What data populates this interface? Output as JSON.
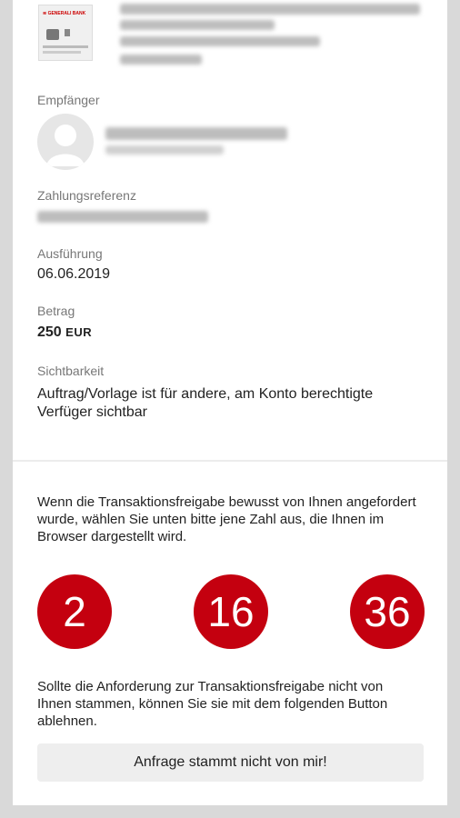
{
  "bank": {
    "logo_text": "≋ GENERALI BANK",
    "icon": "bank-card-icon"
  },
  "recipient": {
    "label": "Empfänger",
    "avatar_icon": "person-placeholder-icon"
  },
  "reference": {
    "label": "Zahlungsreferenz"
  },
  "execution": {
    "label": "Ausführung",
    "value": "06.06.2019"
  },
  "amount": {
    "label": "Betrag",
    "value": "250",
    "currency": "EUR"
  },
  "visibility": {
    "label": "Sichtbarkeit",
    "value": "Auftrag/Vorlage ist für andere, am Konto berechtigte Verfüger sichtbar"
  },
  "confirmation": {
    "instruction": "Wenn die Transaktionsfreigabe bewusst von Ihnen angefordert wurde, wählen Sie unten bitte jene Zahl aus, die Ihnen im Browser dargestellt wird.",
    "numbers": [
      "2",
      "16",
      "36"
    ],
    "reject_info": "Sollte die Anforderung zur Transaktionsfreigabe nicht von Ihnen stammen, können Sie sie mit dem folgenden Button ablehnen.",
    "reject_button": "Anfrage stammt nicht von mir!"
  },
  "colors": {
    "accent": "#c4000f",
    "background": "#d9d9d9",
    "button": "#eeeeee"
  }
}
